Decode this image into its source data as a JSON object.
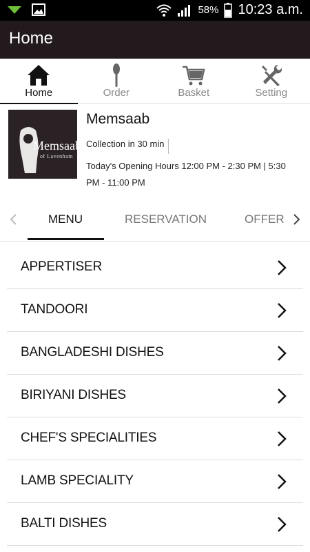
{
  "status_bar": {
    "battery_percent": "58%",
    "time": "10:23 a.m."
  },
  "app_bar": {
    "title": "Home"
  },
  "bottom_tabs": [
    {
      "label": "Home",
      "icon": "home-icon",
      "active": true
    },
    {
      "label": "Order",
      "icon": "spoon-icon",
      "active": false
    },
    {
      "label": "Basket",
      "icon": "cart-icon",
      "active": false
    },
    {
      "label": "Setting",
      "icon": "tools-icon",
      "active": false
    }
  ],
  "restaurant": {
    "logo_text": "Memsaab",
    "logo_subtext": "of Lavenham",
    "name": "Memsaab",
    "collection": "Collection in 30 min",
    "hours": "Today's Opening Hours 12:00 PM - 2:30 PM | 5:30 PM - 11:00 PM"
  },
  "sub_tabs": [
    {
      "label": "MENU",
      "active": true
    },
    {
      "label": "RESERVATION",
      "active": false
    },
    {
      "label": "OFFER",
      "active": false
    }
  ],
  "menu_items": [
    "APPERTISER",
    "TANDOORI",
    "BANGLADESHI DISHES",
    "BIRIYANI DISHES",
    "CHEF'S SPECIALITIES",
    "LAMB SPECIALITY",
    "BALTI DISHES"
  ]
}
